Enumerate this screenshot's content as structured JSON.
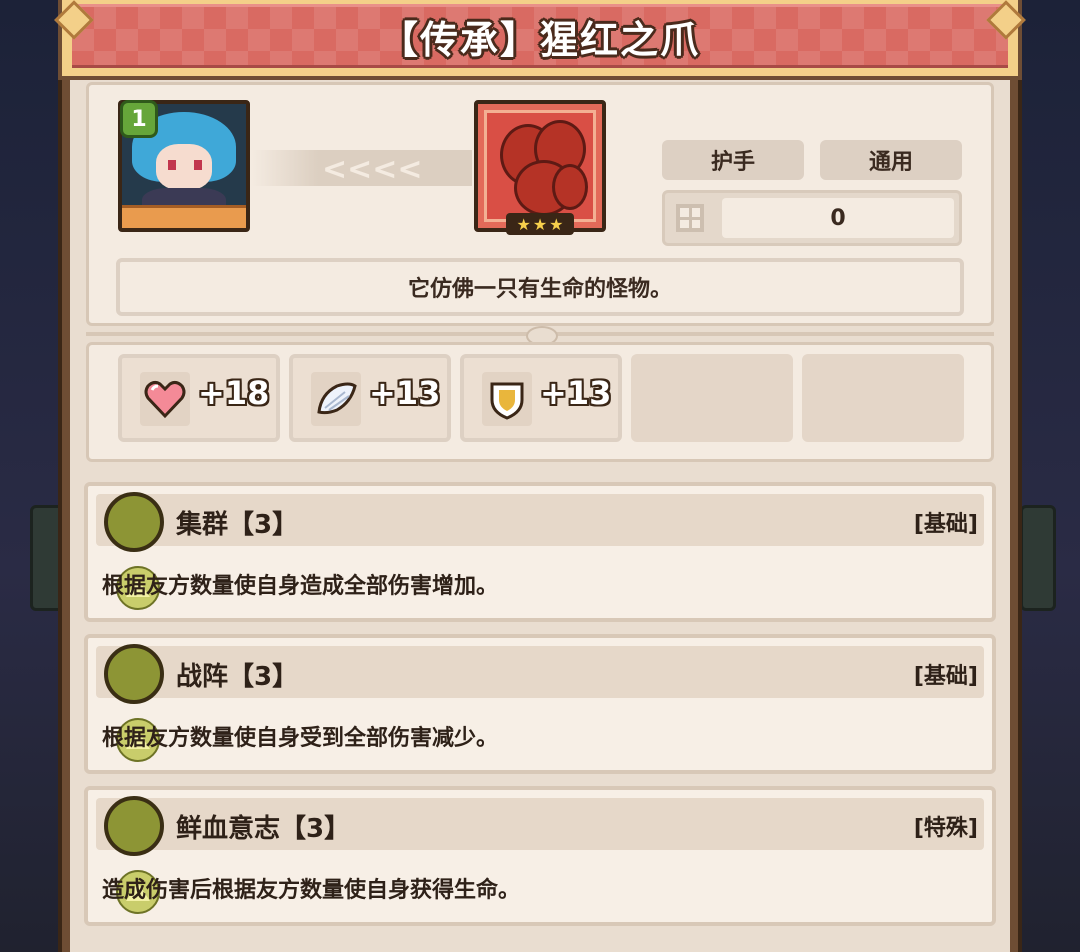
{
  "title": "【传承】猩红之爪",
  "character": {
    "level": "1"
  },
  "item": {
    "stars": [
      "★",
      "★",
      "★"
    ],
    "tags": [
      "护手",
      "通用"
    ],
    "slot_value": "0",
    "description": "它仿佛一只有生命的怪物。",
    "arrows": "<<<<"
  },
  "stats": [
    {
      "icon": "heart-icon",
      "value": "+18"
    },
    {
      "icon": "feather-wing-icon",
      "value": "+13"
    },
    {
      "icon": "shield-icon",
      "value": "+13"
    }
  ],
  "traits": [
    {
      "name": "集群【3】",
      "type": "[基础]",
      "desc": "根据友方数量使自身造成全部伤害增加。"
    },
    {
      "name": "战阵【3】",
      "type": "[基础]",
      "desc": "根据友方数量使自身受到全部伤害减少。"
    },
    {
      "name": "鲜血意志【3】",
      "type": "[特殊]",
      "desc": "造成伤害后根据友方数量使自身获得生命。"
    }
  ],
  "colors": {
    "banner": "#d96a62",
    "frame": "#6e4d34",
    "parchment": "#f4ebe1",
    "trait_icon": "#8d9535"
  }
}
